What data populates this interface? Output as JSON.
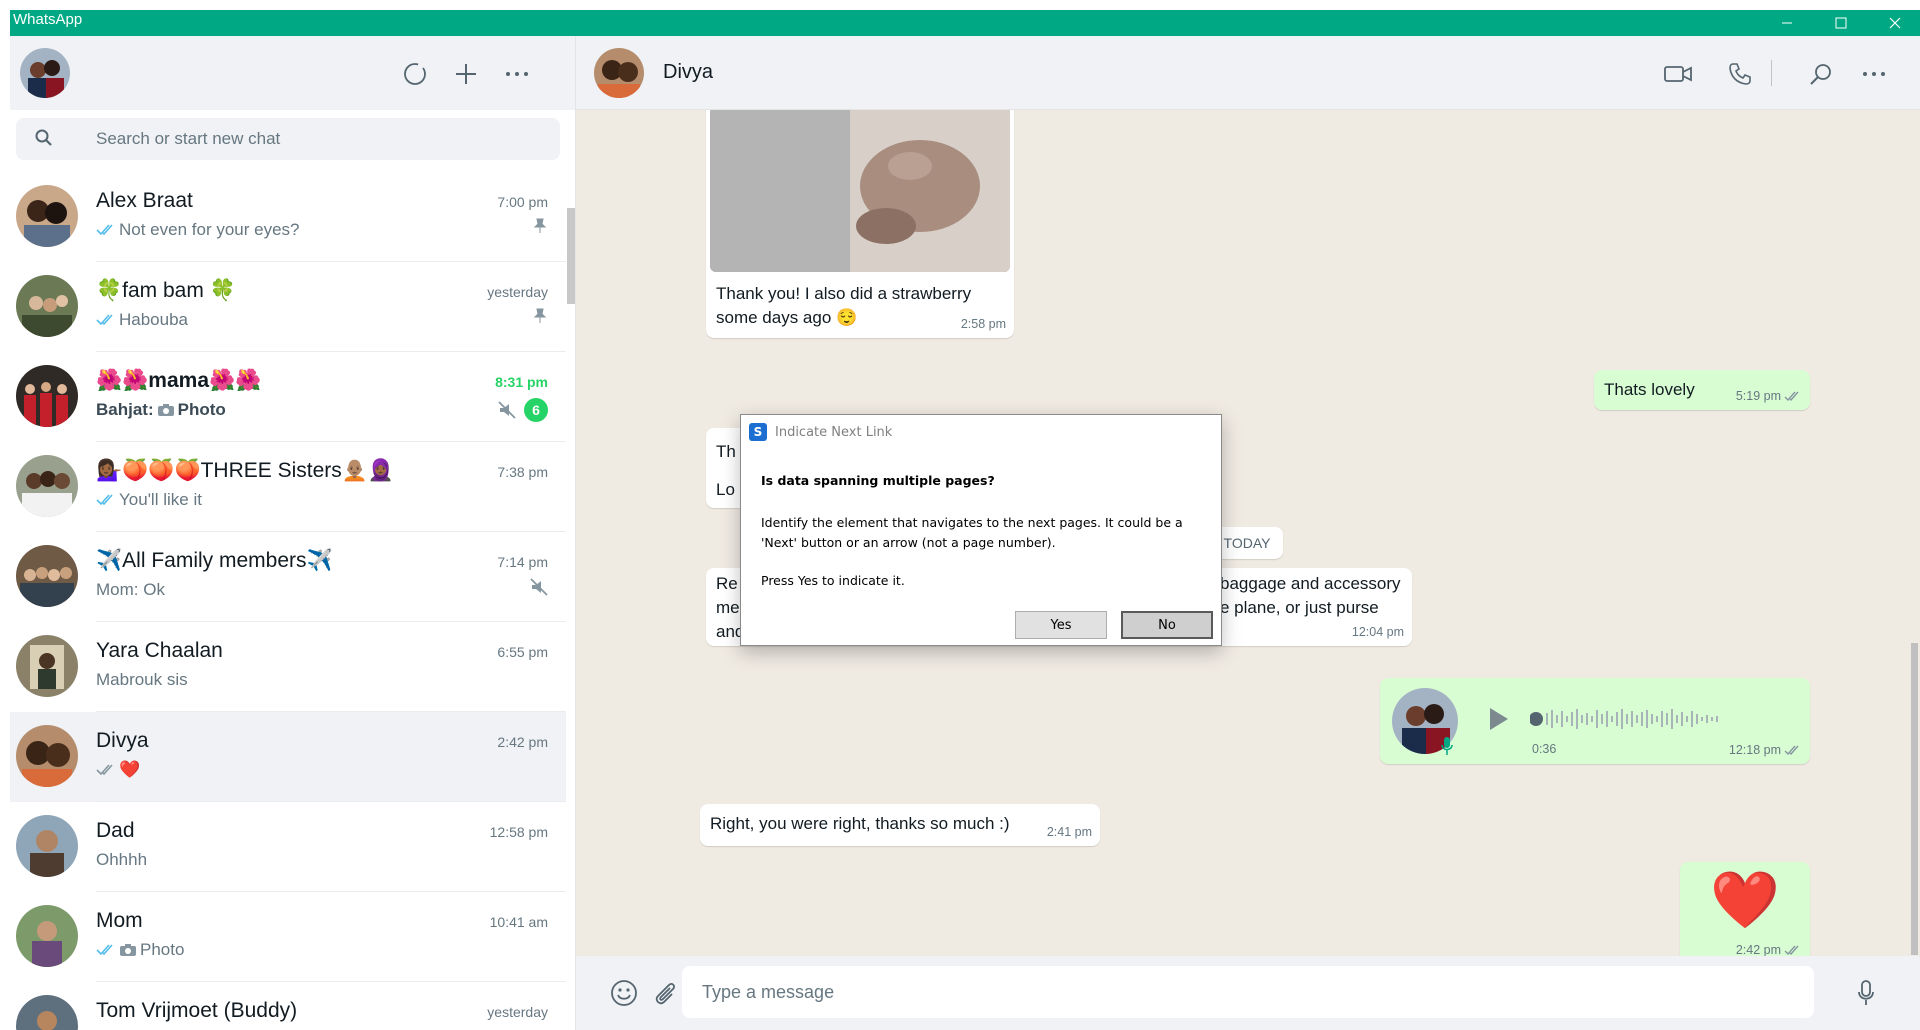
{
  "window": {
    "title": "WhatsApp"
  },
  "colors": {
    "accent": "#00a884",
    "outgoing": "#d9fdd3",
    "unread": "#25d366",
    "tick_read": "#53bdeb"
  },
  "sidebar": {
    "search_placeholder": "Search or start new chat",
    "chats": [
      {
        "name": "Alex Braat",
        "time": "7:00 pm",
        "preview": "Not even for your eyes?",
        "ticks": "read",
        "pinned": true
      },
      {
        "name": "🍀fam bam 🍀",
        "time": "yesterday",
        "preview": "Habouba",
        "ticks": "read",
        "pinned": true
      },
      {
        "name": "🌺🌺mama🌺🌺",
        "time": "8:31 pm",
        "preview_sender": "Bahjat:",
        "preview": "Photo",
        "muted": true,
        "unread": "6",
        "bold": true
      },
      {
        "name": "💁🏾‍♀️🍑🍑🍑THREE Sisters🧑🏽‍🦲🧕🏾",
        "time": "7:38 pm",
        "preview": "You'll like it",
        "ticks": "read"
      },
      {
        "name": "✈️All Family members✈️",
        "time": "7:14 pm",
        "preview": "Mom: Ok",
        "muted": true
      },
      {
        "name": "Yara Chaalan",
        "time": "6:55 pm",
        "preview": "Mabrouk sis"
      },
      {
        "name": "Divya",
        "time": "2:42 pm",
        "preview": "❤️",
        "ticks": "delivered",
        "active": true
      },
      {
        "name": "Dad",
        "time": "12:58 pm",
        "preview": "Ohhhh"
      },
      {
        "name": "Mom",
        "time": "10:41 am",
        "preview": "Photo",
        "ticks": "read",
        "photo": true
      },
      {
        "name": "Tom Vrijmoet (Buddy)",
        "time": "yesterday",
        "preview": ""
      }
    ]
  },
  "chat": {
    "contact_name": "Divya",
    "day_label": "TODAY",
    "messages": {
      "m1_line1": "Thank you! I also did a strawberry",
      "m1_line2": "some days ago 😌",
      "m1_time": "2:58 pm",
      "m2_text": "Thats lovely",
      "m2_time": "5:19 pm",
      "m3_line1": "Th",
      "m3_line2": "Lo",
      "m4_line1": "Re",
      "m4_line2": "me",
      "m4_line3": "and backpack?",
      "m4_r1": "baggage and accessory",
      "m4_r2": "e plane, or just purse",
      "m4_time": "12:04 pm",
      "voice_duration": "0:36",
      "voice_time": "12:18 pm",
      "m6_text": "Right, you were right, thanks so much :)",
      "m6_time": "2:41 pm",
      "m7_emoji": "❤️",
      "m7_time": "2:42 pm"
    },
    "composer_placeholder": "Type a message"
  },
  "dialog": {
    "title": "Indicate Next Link",
    "icon_letter": "S",
    "question": "Is data spanning multiple pages?",
    "body": "Identify the element that navigates to the next pages. It could be a 'Next' button or an arrow (not a page number).",
    "prompt": "Press Yes to indicate it.",
    "yes_label": "Yes",
    "no_label": "No"
  }
}
